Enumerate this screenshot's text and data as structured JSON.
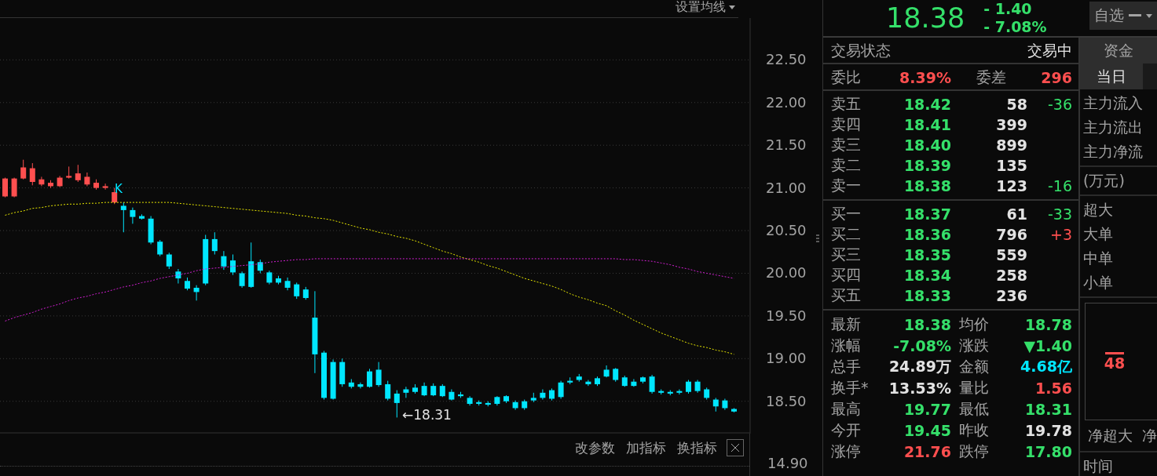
{
  "chart": {
    "settings_menu": "设置均线",
    "marker": "K",
    "low_label": "←18.31",
    "chart_data": {
      "type": "candlestick",
      "grid": true,
      "categories": [
        null,
        null,
        null,
        null,
        null,
        null,
        null,
        null,
        null,
        null,
        null,
        null,
        null,
        null,
        null,
        null,
        null,
        null,
        null,
        null,
        null,
        null,
        null,
        null,
        null,
        null,
        null,
        null,
        null,
        null,
        null,
        null,
        null,
        null,
        null,
        null,
        null,
        null,
        null,
        null,
        null,
        null,
        null,
        null,
        null,
        null,
        null,
        null,
        null,
        null,
        null,
        null,
        null,
        null,
        null,
        null,
        null,
        null,
        null,
        null,
        null,
        null,
        null,
        null,
        null,
        null,
        null,
        null,
        null,
        null,
        null,
        null,
        null,
        null,
        null,
        null,
        null,
        null,
        null,
        null,
        null
      ],
      "ylim": [
        18.13,
        22.99
      ],
      "ohlc": [
        [
          20.9,
          21.12,
          20.89,
          21.11
        ],
        [
          20.9,
          21.12,
          20.89,
          21.11
        ],
        [
          21.11,
          21.33,
          21.1,
          21.24
        ],
        [
          21.07,
          21.29,
          21.03,
          21.23
        ],
        [
          21.04,
          21.13,
          21.02,
          21.1
        ],
        [
          21.02,
          21.09,
          21.0,
          21.06
        ],
        [
          21.02,
          21.14,
          21.01,
          21.12
        ],
        [
          21.12,
          21.25,
          21.11,
          21.14
        ],
        [
          21.09,
          21.27,
          21.07,
          21.17
        ],
        [
          21.04,
          21.18,
          21.02,
          21.13
        ],
        [
          21.0,
          21.1,
          20.98,
          21.06
        ],
        [
          21.0,
          21.05,
          20.98,
          21.02
        ],
        [
          20.83,
          21.0,
          20.81,
          20.95
        ],
        [
          20.79,
          20.83,
          20.48,
          20.74
        ],
        [
          20.74,
          20.77,
          20.58,
          20.66
        ],
        [
          20.67,
          20.69,
          20.63,
          20.64
        ],
        [
          20.64,
          20.67,
          20.34,
          20.36
        ],
        [
          20.37,
          20.39,
          20.2,
          20.22
        ],
        [
          20.22,
          20.24,
          20.05,
          20.08
        ],
        [
          20.02,
          20.05,
          19.88,
          19.94
        ],
        [
          19.91,
          19.95,
          19.8,
          19.82
        ],
        [
          19.83,
          19.86,
          19.68,
          19.78
        ],
        [
          20.4,
          20.45,
          19.86,
          19.88
        ],
        [
          20.4,
          20.48,
          20.22,
          20.26
        ],
        [
          20.2,
          20.26,
          20.04,
          20.08
        ],
        [
          20.15,
          20.22,
          19.98,
          20.01
        ],
        [
          20.0,
          20.02,
          19.83,
          19.85
        ],
        [
          20.14,
          20.36,
          19.83,
          19.84
        ],
        [
          20.13,
          20.16,
          20.0,
          20.03
        ],
        [
          20.01,
          20.03,
          19.87,
          19.89
        ],
        [
          19.94,
          19.97,
          19.87,
          19.89
        ],
        [
          19.91,
          19.95,
          19.8,
          19.83
        ],
        [
          19.87,
          19.89,
          19.7,
          19.73
        ],
        [
          19.81,
          19.84,
          19.69,
          19.71
        ],
        [
          19.48,
          19.79,
          18.83,
          19.05
        ],
        [
          19.07,
          19.09,
          18.52,
          18.54
        ],
        [
          18.96,
          18.99,
          18.52,
          18.53
        ],
        [
          18.96,
          19.0,
          18.67,
          18.7
        ],
        [
          18.72,
          18.76,
          18.65,
          18.67
        ],
        [
          18.7,
          18.72,
          18.65,
          18.67
        ],
        [
          18.85,
          18.88,
          18.66,
          18.67
        ],
        [
          18.87,
          18.96,
          18.67,
          18.69
        ],
        [
          18.7,
          18.74,
          18.51,
          18.53
        ],
        [
          18.59,
          18.63,
          18.31,
          18.48
        ],
        [
          18.64,
          18.67,
          18.54,
          18.6
        ],
        [
          18.66,
          18.7,
          18.59,
          18.61
        ],
        [
          18.68,
          18.72,
          18.56,
          18.57
        ],
        [
          18.68,
          18.71,
          18.56,
          18.57
        ],
        [
          18.68,
          18.7,
          18.55,
          18.56
        ],
        [
          18.61,
          18.64,
          18.51,
          18.52
        ],
        [
          18.58,
          18.61,
          18.54,
          18.56
        ],
        [
          18.54,
          18.56,
          18.45,
          18.47
        ],
        [
          18.49,
          18.51,
          18.45,
          18.47
        ],
        [
          18.48,
          18.5,
          18.44,
          18.46
        ],
        [
          18.55,
          18.56,
          18.45,
          18.47
        ],
        [
          18.56,
          18.57,
          18.48,
          18.5
        ],
        [
          18.49,
          18.51,
          18.4,
          18.42
        ],
        [
          18.5,
          18.52,
          18.4,
          18.42
        ],
        [
          18.54,
          18.6,
          18.49,
          18.51
        ],
        [
          18.6,
          18.64,
          18.52,
          18.54
        ],
        [
          18.63,
          18.65,
          18.51,
          18.53
        ],
        [
          18.72,
          18.74,
          18.53,
          18.55
        ],
        [
          18.74,
          18.78,
          18.7,
          18.72
        ],
        [
          18.79,
          18.82,
          18.73,
          18.75
        ],
        [
          18.73,
          18.75,
          18.68,
          18.7
        ],
        [
          18.77,
          18.79,
          18.68,
          18.7
        ],
        [
          18.87,
          18.92,
          18.78,
          18.79
        ],
        [
          18.88,
          18.89,
          18.73,
          18.75
        ],
        [
          18.78,
          18.8,
          18.67,
          18.68
        ],
        [
          18.73,
          18.76,
          18.67,
          18.68
        ],
        [
          18.78,
          18.79,
          18.71,
          18.73
        ],
        [
          18.79,
          18.81,
          18.59,
          18.61
        ],
        [
          18.62,
          18.64,
          18.58,
          18.6
        ],
        [
          18.61,
          18.63,
          18.57,
          18.59
        ],
        [
          18.62,
          18.64,
          18.58,
          18.6
        ],
        [
          18.73,
          18.75,
          18.59,
          18.61
        ],
        [
          18.73,
          18.75,
          18.6,
          18.62
        ],
        [
          18.64,
          18.66,
          18.52,
          18.54
        ],
        [
          18.52,
          18.54,
          18.38,
          18.44
        ],
        [
          18.51,
          18.53,
          18.4,
          18.42
        ],
        [
          18.41,
          18.42,
          18.37,
          18.38
        ]
      ],
      "yticks": [
        {
          "value": 22.5,
          "label": "22.50"
        },
        {
          "value": 22,
          "label": "22.00"
        },
        {
          "value": 21.5,
          "label": "21.50"
        },
        {
          "value": 21,
          "label": "21.00"
        },
        {
          "value": 20.5,
          "label": "20.50"
        },
        {
          "value": 20,
          "label": "20.00"
        },
        {
          "value": 19.5,
          "label": "19.50"
        },
        {
          "value": 19,
          "label": "19.00"
        },
        {
          "value": 18.5,
          "label": "18.50"
        }
      ],
      "series": [
        {
          "type": "line",
          "color": "#e8e800",
          "line_style": "dashed",
          "values": [
            20.68,
            20.71,
            20.73,
            20.76,
            20.77,
            20.79,
            20.8,
            20.81,
            20.81,
            20.82,
            20.82,
            20.83,
            20.83,
            20.83,
            20.83,
            20.83,
            20.83,
            20.83,
            20.83,
            20.82,
            20.81,
            20.8,
            20.79,
            20.78,
            20.77,
            20.76,
            20.75,
            20.74,
            20.73,
            20.72,
            20.71,
            20.7,
            20.68,
            20.67,
            20.65,
            20.64,
            20.62,
            20.59,
            20.56,
            20.53,
            20.51,
            20.48,
            20.46,
            20.43,
            20.41,
            20.38,
            20.34,
            20.3,
            20.26,
            20.23,
            20.19,
            20.16,
            20.13,
            20.09,
            20.06,
            20.02,
            19.98,
            19.94,
            19.91,
            19.88,
            19.85,
            19.81,
            19.76,
            19.72,
            19.69,
            19.65,
            19.62,
            19.56,
            19.51,
            19.45,
            19.4,
            19.35,
            19.3,
            19.26,
            19.22,
            19.18,
            19.15,
            19.13,
            19.1,
            19.08,
            19.05
          ]
        },
        {
          "type": "line",
          "color": "#d21ed2",
          "line_style": "dashed",
          "values": [
            19.44,
            19.48,
            19.51,
            19.54,
            19.58,
            19.61,
            19.64,
            19.68,
            19.71,
            19.73,
            19.76,
            19.78,
            19.81,
            19.84,
            19.86,
            19.89,
            19.91,
            19.94,
            19.96,
            19.98,
            20.0,
            20.03,
            20.05,
            20.06,
            20.07,
            20.08,
            20.09,
            20.1,
            20.11,
            20.13,
            20.14,
            20.15,
            20.16,
            20.16,
            20.17,
            20.17,
            20.17,
            20.17,
            20.17,
            20.17,
            20.17,
            20.17,
            20.17,
            20.17,
            20.17,
            20.17,
            20.17,
            20.17,
            20.17,
            20.17,
            20.17,
            20.17,
            20.17,
            20.17,
            20.17,
            20.17,
            20.17,
            20.17,
            20.17,
            20.17,
            20.17,
            20.17,
            20.17,
            20.17,
            20.17,
            20.17,
            20.17,
            20.17,
            20.16,
            20.16,
            20.15,
            20.14,
            20.12,
            20.1,
            20.07,
            20.05,
            20.02,
            20.0,
            19.98,
            19.96,
            19.94
          ]
        }
      ]
    }
  },
  "indicator": {
    "y_tick": "14.90",
    "buttons": [
      "改参数",
      "加指标",
      "换指标"
    ]
  },
  "quote": {
    "price": "18.38",
    "change": "- 1.40",
    "change_pct": "- 7.08%",
    "watchlist_button": "自选"
  },
  "status": {
    "label": "交易状态",
    "value": "交易中"
  },
  "ratio": [
    {
      "label": "委比",
      "value": "8.39%",
      "color": "#ff4f4f"
    },
    {
      "label": "委差",
      "value": "296",
      "color": "#ff4f4f"
    }
  ],
  "asks": [
    {
      "label": "卖五",
      "price": "18.42",
      "volume": "58",
      "change": "-36",
      "color": "#35e06a"
    },
    {
      "label": "卖四",
      "price": "18.41",
      "volume": "399"
    },
    {
      "label": "卖三",
      "price": "18.40",
      "volume": "899"
    },
    {
      "label": "卖二",
      "price": "18.39",
      "volume": "135"
    },
    {
      "label": "卖一",
      "price": "18.38",
      "volume": "123",
      "change": "-16",
      "color": "#35e06a"
    }
  ],
  "bids": [
    {
      "label": "买一",
      "price": "18.37",
      "volume": "61",
      "change": "-33",
      "color": "#35e06a"
    },
    {
      "label": "买二",
      "price": "18.36",
      "volume": "796",
      "change": "+3",
      "color": "#ff4f4f"
    },
    {
      "label": "买三",
      "price": "18.35",
      "volume": "559"
    },
    {
      "label": "买四",
      "price": "18.34",
      "volume": "258"
    },
    {
      "label": "买五",
      "price": "18.33",
      "volume": "236"
    }
  ],
  "stats": [
    {
      "label": "最新",
      "value": "18.38",
      "color": "#35e06a"
    },
    {
      "label": "均价",
      "value": "18.78",
      "color": "#35e06a"
    },
    {
      "label": "涨幅",
      "value": "-7.08%",
      "color": "#35e06a"
    },
    {
      "label": "涨跌",
      "value": "▼1.40",
      "color": "#35e06a"
    },
    {
      "label": "总手",
      "value": "24.89万",
      "color": "#e2e2e2"
    },
    {
      "label": "金额",
      "value": "4.68亿",
      "color": "#00e6ff"
    },
    {
      "label": "换手*",
      "value": "13.53%",
      "color": "#e2e2e2"
    },
    {
      "label": "量比",
      "value": "1.56",
      "color": "#ff4f4f"
    },
    {
      "label": "最高",
      "value": "19.77",
      "color": "#35e06a"
    },
    {
      "label": "最低",
      "value": "18.31",
      "color": "#35e06a"
    },
    {
      "label": "今开",
      "value": "19.45",
      "color": "#35e06a"
    },
    {
      "label": "昨收",
      "value": "19.78",
      "color": "#e2e2e2"
    },
    {
      "label": "涨停",
      "value": "21.76",
      "color": "#ff4f4f"
    },
    {
      "label": "跌停",
      "value": "17.80",
      "color": "#35e06a"
    }
  ],
  "fund_panel": {
    "title": "资金",
    "period_tabs": [
      {
        "label": "当日",
        "selected": true
      }
    ],
    "flows": [
      "主力流入",
      "主力流出",
      "主力净流"
    ],
    "unit": "(万元)",
    "orders": [
      "超大",
      "大单",
      "中单",
      "小单"
    ],
    "bar_value": "48",
    "net_labels": [
      "净超大",
      "净"
    ],
    "time_label": "时间"
  }
}
